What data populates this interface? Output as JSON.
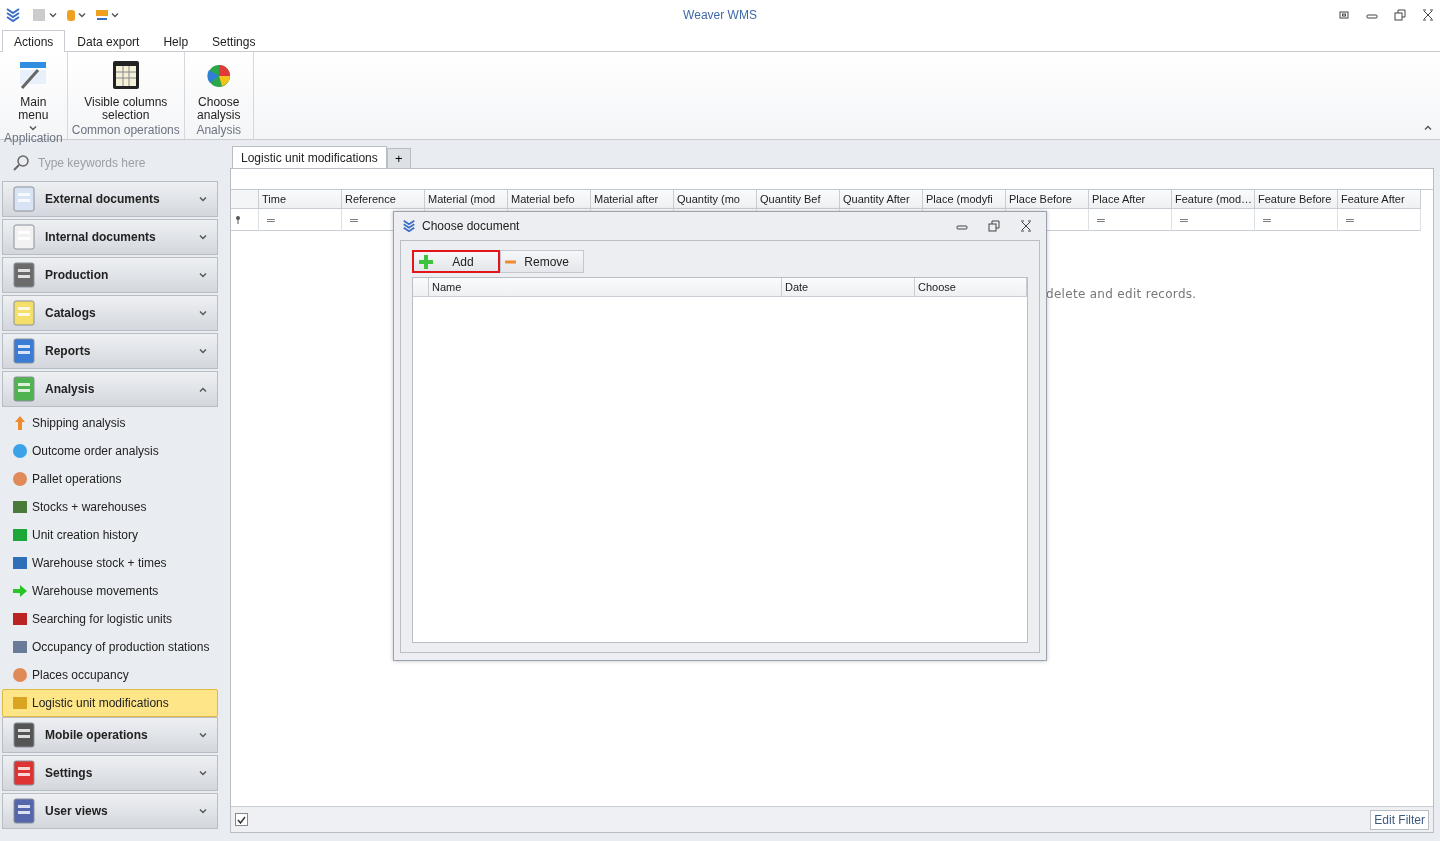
{
  "window": {
    "title": "Weaver WMS"
  },
  "ribbon": {
    "tabs": [
      {
        "label": "Actions",
        "selected": true
      },
      {
        "label": "Data export",
        "selected": false
      },
      {
        "label": "Help",
        "selected": false
      },
      {
        "label": "Settings",
        "selected": false
      }
    ],
    "groups": [
      {
        "label": "Application",
        "buttons": [
          {
            "label": "Main menu",
            "dropdown": true
          }
        ]
      },
      {
        "label": "Common operations",
        "buttons": [
          {
            "label": "Visible columns selection",
            "dropdown": false
          }
        ]
      },
      {
        "label": "Analysis",
        "buttons": [
          {
            "label": "Choose analysis",
            "dropdown": false
          }
        ]
      }
    ]
  },
  "sidebar": {
    "search": {
      "placeholder": "Type keywords here"
    },
    "groups": [
      {
        "label": "External documents",
        "expanded": false
      },
      {
        "label": "Internal documents",
        "expanded": false
      },
      {
        "label": "Production",
        "expanded": false
      },
      {
        "label": "Catalogs",
        "expanded": false
      },
      {
        "label": "Reports",
        "expanded": false
      },
      {
        "label": "Analysis",
        "expanded": true,
        "items": [
          {
            "label": "Shipping analysis",
            "selected": false
          },
          {
            "label": "Outcome order analysis",
            "selected": false
          },
          {
            "label": "Pallet operations",
            "selected": false
          },
          {
            "label": "Stocks + warehouses",
            "selected": false
          },
          {
            "label": "Unit creation history",
            "selected": false
          },
          {
            "label": "Warehouse stock + times",
            "selected": false
          },
          {
            "label": "Warehouse movements",
            "selected": false
          },
          {
            "label": "Searching for logistic units",
            "selected": false
          },
          {
            "label": "Occupancy of production stations",
            "selected": false
          },
          {
            "label": "Places occupancy",
            "selected": false
          },
          {
            "label": "Logistic unit modifications",
            "selected": true
          }
        ]
      },
      {
        "label": "Mobile operations",
        "expanded": false
      },
      {
        "label": "Settings",
        "expanded": false
      },
      {
        "label": "User views",
        "expanded": false
      }
    ]
  },
  "document_tabs": {
    "tabs": [
      {
        "label": "Logistic unit modifications",
        "selected": true
      }
    ],
    "add_label": "+"
  },
  "grid": {
    "columns": [
      {
        "label": "Time",
        "filter": "═"
      },
      {
        "label": "Reference",
        "filter": "═"
      },
      {
        "label": "Material (mod"
      },
      {
        "label": "Material befo"
      },
      {
        "label": "Material after"
      },
      {
        "label": "Quantity (mo"
      },
      {
        "label": "Quantity Bef"
      },
      {
        "label": "Quantity After"
      },
      {
        "label": "Place (modyfi"
      },
      {
        "label": "Place Before"
      },
      {
        "label": "Place After",
        "filter": "═"
      },
      {
        "label": "Feature (mod…",
        "filter": "═"
      },
      {
        "label": "Feature Before",
        "filter": "═"
      },
      {
        "label": "Feature After",
        "filter": "═"
      }
    ],
    "empty_message": "delete and edit records."
  },
  "footer": {
    "filter_enabled": true,
    "edit_filter": "Edit Filter"
  },
  "dialog": {
    "title": "Choose document",
    "buttons": [
      {
        "label": "Add",
        "kind": "add",
        "focused": true
      },
      {
        "label": "Remove",
        "kind": "remove",
        "focused": false
      }
    ],
    "columns": [
      "Name",
      "Date",
      "Choose"
    ]
  }
}
